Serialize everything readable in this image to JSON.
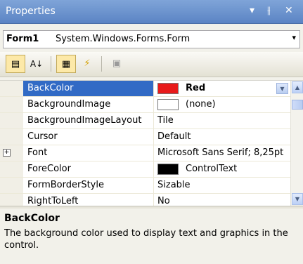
{
  "titlebar": {
    "title": "Properties",
    "menu_glyph": "▾",
    "pin_glyph": "ꟸ",
    "close_glyph": "✕"
  },
  "object_selector": {
    "name": "Form1",
    "type": "System.Windows.Forms.Form",
    "arrow_glyph": "▾"
  },
  "toolbar": {
    "categorized_icon": "▤",
    "alphabetical_icon": "A↓",
    "properties_icon": "▦",
    "events_icon": "⚡",
    "pages_icon": "▣"
  },
  "grid": {
    "rows": [
      {
        "name": "BackColor",
        "value": "Red",
        "swatch": "#e81a1a",
        "selected": true,
        "bold": true,
        "has_dropdown": true
      },
      {
        "name": "BackgroundImage",
        "value": "(none)",
        "swatch": "#ffffff"
      },
      {
        "name": "BackgroundImageLayout",
        "value": "Tile"
      },
      {
        "name": "Cursor",
        "value": "Default"
      },
      {
        "name": "Font",
        "value": "Microsoft Sans Serif; 8,25pt",
        "expander": "⊞"
      },
      {
        "name": "ForeColor",
        "value": "ControlText",
        "swatch": "#000000"
      },
      {
        "name": "FormBorderStyle",
        "value": "Sizable"
      },
      {
        "name": "RightToLeft",
        "value": "No"
      }
    ],
    "dropdown_glyph": "▼",
    "scroll_up_glyph": "▲",
    "scroll_down_glyph": "▼"
  },
  "description": {
    "title": "BackColor",
    "text": "The background color used to display text and graphics in the control."
  },
  "colors": {
    "title_bar": "#5b84c4",
    "selection": "#316ac5"
  }
}
